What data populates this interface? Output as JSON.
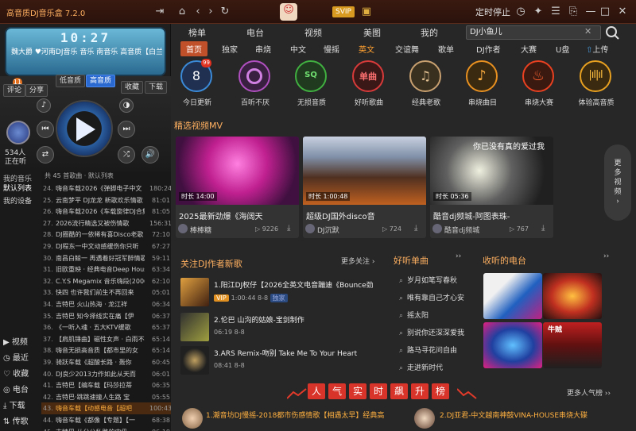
{
  "window": {
    "title": "高音质DJ音乐盒 7.2.0",
    "svip": "SVIP",
    "timer": "定时停止"
  },
  "lcd": {
    "time": "10:27",
    "line1": "魏大爵 ♥河南DJ音乐   音乐   南音乐 高音质【白兰需要】【专栏】",
    "line2": ""
  },
  "player": {
    "btn_comment": "评论",
    "btn_share": "分享",
    "btn_low": "低音质",
    "btn_high": "高音质",
    "btn_fav": "收藏",
    "btn_download": "下载",
    "badge": "11",
    "listeners": "534人",
    "listening": "正在听"
  },
  "sidebar": {
    "head": "我的音乐",
    "items": [
      {
        "label": "默认列表"
      },
      {
        "label": "我的设备"
      }
    ],
    "bottom": [
      {
        "label": "视频"
      },
      {
        "label": "最近"
      },
      {
        "label": "收藏"
      },
      {
        "label": "电台"
      },
      {
        "label": "下载"
      },
      {
        "label": "传歌"
      }
    ]
  },
  "playlist": {
    "header": "共 45 首歌曲 · 默认列表",
    "rows": [
      {
        "n": "24.",
        "t": "嗨音车载2026《弹脚电子中文",
        "d": "180:24"
      },
      {
        "n": "25.",
        "t": "云南梦平 DJ龙龙 新歌欢乐情歌",
        "d": "81:01"
      },
      {
        "n": "26.",
        "t": "嗨音车载2026《车载旋律DJ合集",
        "d": "81:05"
      },
      {
        "n": "27.",
        "t": "2026流行精选又被伤情歌",
        "d": "156:31"
      },
      {
        "n": "28.",
        "t": "DJ圈酷的一依稀有喜Disco老歌",
        "d": "72:10"
      },
      {
        "n": "29.",
        "t": "DJ程东一中文动感缓伤你只听",
        "d": "67:27"
      },
      {
        "n": "30.",
        "t": "南昌白鲸一 再遇着好冠军醉情歌",
        "d": "59:11"
      },
      {
        "n": "31.",
        "t": "旧欧重映 · 经典电音Deep House",
        "d": "63:34"
      },
      {
        "n": "32.",
        "t": "C.Y.S Megamix 音乐嗨段(2006)",
        "d": "62:10"
      },
      {
        "n": "33.",
        "t": "快四 也许我们前生不再回来",
        "d": "05:01"
      },
      {
        "n": "34.",
        "t": "吉特巴 火山热海 · 龙江祥",
        "d": "06:34"
      },
      {
        "n": "35.",
        "t": "吉特巴 知今择线实在痛【伊",
        "d": "06:37"
      },
      {
        "n": "36.",
        "t": "《一听入魂 · 五大KTV缓歌",
        "d": "65:37"
      },
      {
        "n": "37.",
        "t": "【肩肌锤曲】磁性女声 · 白雨不",
        "d": "65:14"
      },
      {
        "n": "38.",
        "t": "嗨音无损高音质【都市里的女",
        "d": "65:14"
      },
      {
        "n": "39.",
        "t": "骑跃车载《超酸长路 · 轰你",
        "d": "60:45"
      },
      {
        "n": "40.",
        "t": "DJ良少2013力作如此从天而",
        "d": "06:01"
      },
      {
        "n": "41.",
        "t": "吉特巴【编车载【玛莎拉蒂",
        "d": "06:35"
      },
      {
        "n": "42.",
        "t": "吉特巴·跳跳速撞人生路 宝",
        "d": "05:55"
      },
      {
        "n": "43.",
        "t": "嗨音车载【动感电音【超吧",
        "d": "100:43"
      },
      {
        "n": "44.",
        "t": "嗨音车载《都像【专题】【一",
        "d": "68:38"
      },
      {
        "n": "45.",
        "t": "吉特巴·从分公私路的中仍",
        "d": "06:18"
      }
    ]
  },
  "topnav": [
    {
      "label": "榜单"
    },
    {
      "label": "电台"
    },
    {
      "label": "视频"
    },
    {
      "label": "美图"
    },
    {
      "label": "我的"
    }
  ],
  "search": {
    "value": "DJ小鱼儿"
  },
  "subnav": [
    {
      "label": "首页"
    },
    {
      "label": "独家"
    },
    {
      "label": "串烧"
    },
    {
      "label": "中文"
    },
    {
      "label": "慢摇"
    },
    {
      "label": "英文"
    },
    {
      "label": "交谊舞"
    },
    {
      "label": "歌单"
    },
    {
      "label": "DJ作者"
    },
    {
      "label": "大赛"
    },
    {
      "label": "U盘"
    },
    {
      "label": "上传"
    }
  ],
  "categories": [
    {
      "label": "今日更新",
      "badge": "99",
      "num": "8",
      "color": "#3a8ad8"
    },
    {
      "label": "百听不厌",
      "color": "#b050c0"
    },
    {
      "label": "无损音质",
      "color": "#40b040"
    },
    {
      "label": "好听歌曲",
      "text": "单曲",
      "color": "#d83a3a"
    },
    {
      "label": "经典老歌",
      "color": "#c8a070"
    },
    {
      "label": "串烧曲目",
      "color": "#e89020"
    },
    {
      "label": "串烧大赛",
      "color": "#e84020"
    },
    {
      "label": "体验高音质",
      "color": "#e8a020"
    }
  ],
  "mv_section": {
    "title": "精选视频MV",
    "more": "更多视频",
    "cards": [
      {
        "title": "2025最新劲爆《海阔天",
        "duration": "时长 14:00",
        "author": "棒棒糖",
        "plays": "9226"
      },
      {
        "title": "超级DJ国外disco音",
        "duration": "时长 1:00:48",
        "author": "DJ沉默",
        "plays": "724"
      },
      {
        "title": "酷音dj频城-阿图表珠-",
        "duration": "时长 05:36",
        "author": "酷音dj频城",
        "plays": "767"
      }
    ],
    "overlay_text": "你已没有真的爱过我"
  },
  "dj_section": {
    "title": "关注DJ作者新歌",
    "more": "更多关注",
    "rows": [
      {
        "title": "1.阳江DJ权仔【2026全英文电音蹦迪《Bounce劲",
        "time": "1:00:44",
        "date": "8-8",
        "vip": "VIP",
        "solo": "独家"
      },
      {
        "title": "2.伦巴 山沟的姑娘-宝剑制作",
        "time": "06:19",
        "date": "8-8"
      },
      {
        "title": "3.ARS Remix-吻别 Take Me To Your Heart",
        "time": "08:41",
        "date": "8-8"
      }
    ]
  },
  "fav_section": {
    "title": "好听单曲",
    "items": [
      {
        "label": "岁月如笔写春秋"
      },
      {
        "label": "唯有靠自己才心安"
      },
      {
        "label": "摇太阳"
      },
      {
        "label": "别说你还深深爱我"
      },
      {
        "label": "路马寻花问自由"
      },
      {
        "label": "走进新时代"
      }
    ]
  },
  "station_section": {
    "title": "收听的电台",
    "labels": [
      "",
      "",
      "",
      "牛贼"
    ]
  },
  "hot_section": {
    "chars": [
      "人",
      "气",
      "实",
      "时",
      "飙",
      "升",
      "榜"
    ],
    "more": "更多人气榜",
    "item1": "1.潮音坊DJ慢摇-2018都市伤感情歌【相遇太早】经典高",
    "item2": "2.DJ亚君-中文越南神鼓VINA-HOUSE串烧大碟"
  }
}
